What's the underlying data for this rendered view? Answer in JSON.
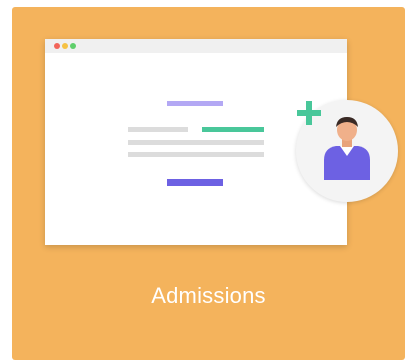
{
  "tile": {
    "label": "Admissions",
    "background_color": "#f4b35c"
  },
  "icons": {
    "browser": "browser-window-icon",
    "user": "user-avatar-icon",
    "add": "plus-icon"
  },
  "colors": {
    "accent_purple": "#6d61e3",
    "accent_green": "#49c79a",
    "light_purple": "#b3a8f4"
  }
}
